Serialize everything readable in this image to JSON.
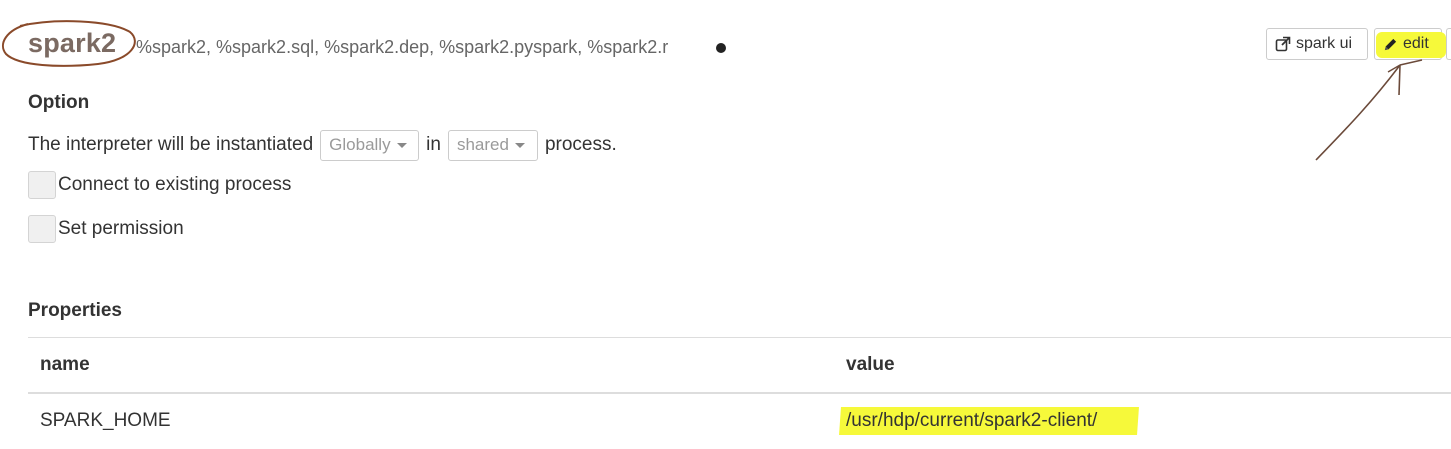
{
  "interpreter": {
    "name": "spark2",
    "aliases": "%spark2, %spark2.sql, %spark2.dep, %spark2.pyspark, %spark2.r",
    "status_icon": "running-dot-icon"
  },
  "toolbar": {
    "spark_ui_label": "spark ui",
    "spark_ui_icon": "external-link-icon",
    "edit_label": "edit",
    "edit_icon": "pencil-icon",
    "highlight_color": "#f6f93a"
  },
  "option": {
    "title": "Option",
    "sentence_start": "The interpreter will be instantiated",
    "scope_value": "Globally",
    "sentence_in": "in",
    "mode_value": "shared",
    "sentence_end": "process.",
    "connect_existing_label": "Connect to existing process",
    "set_permission_label": "Set permission"
  },
  "properties": {
    "title": "Properties",
    "columns": [
      "name",
      "value"
    ],
    "rows": [
      {
        "name": "SPARK_HOME",
        "value": "/usr/hdp/current/spark2-client/"
      }
    ]
  }
}
